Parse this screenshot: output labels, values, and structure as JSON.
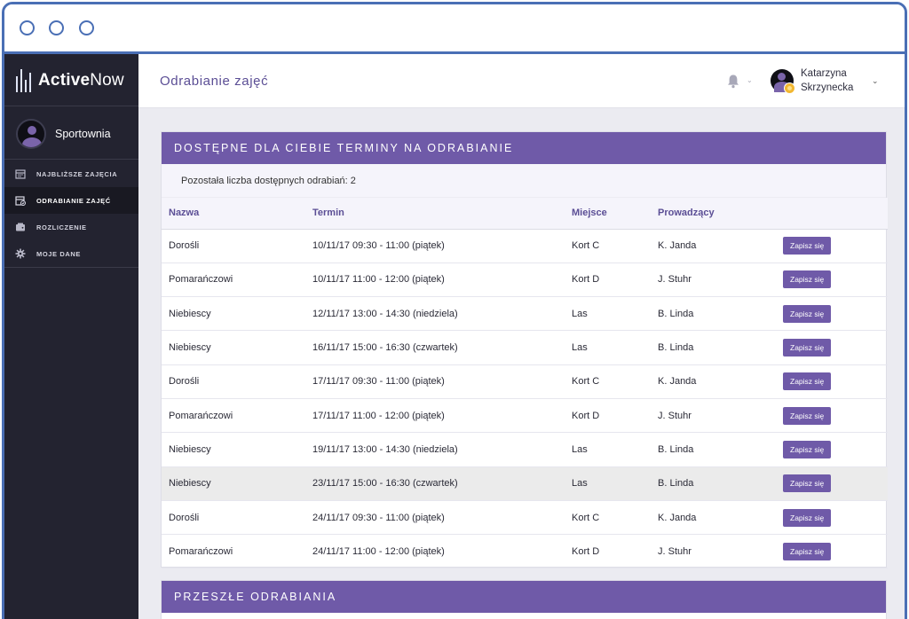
{
  "app": {
    "logo_bold": "Active",
    "logo_light": "Now"
  },
  "sidebar": {
    "company": "Sportownia",
    "items": [
      {
        "label": "Najbliższe zajęcia",
        "icon": "calendar-icon"
      },
      {
        "label": "Odrabianie zajęć",
        "icon": "calendar-check-icon"
      },
      {
        "label": "Rozliczenie",
        "icon": "wallet-icon"
      },
      {
        "label": "Moje dane",
        "icon": "gear-icon"
      }
    ]
  },
  "header": {
    "title": "Odrabianie zajęć",
    "user_first": "Katarzyna",
    "user_last": "Skrzynecka"
  },
  "available": {
    "title": "Dostępne dla ciebie terminy na odrabianie",
    "remaining": "Pozostała liczba dostępnych odrabiań: 2",
    "columns": [
      "Nazwa",
      "Termin",
      "Miejsce",
      "Prowadzący"
    ],
    "button_label": "Zapisz się",
    "rows": [
      {
        "name": "Dorośli",
        "date": "10/11/17 09:30 - 11:00 (piątek)",
        "place": "Kort C",
        "coach": "K. Janda"
      },
      {
        "name": "Pomarańczowi",
        "date": "10/11/17 11:00 - 12:00 (piątek)",
        "place": "Kort D",
        "coach": "J. Stuhr"
      },
      {
        "name": "Niebiescy",
        "date": "12/11/17 13:00 - 14:30 (niedziela)",
        "place": "Las",
        "coach": "B. Linda"
      },
      {
        "name": "Niebiescy",
        "date": "16/11/17 15:00 - 16:30 (czwartek)",
        "place": "Las",
        "coach": "B. Linda"
      },
      {
        "name": "Dorośli",
        "date": "17/11/17 09:30 - 11:00 (piątek)",
        "place": "Kort C",
        "coach": "K. Janda"
      },
      {
        "name": "Pomarańczowi",
        "date": "17/11/17 11:00 - 12:00 (piątek)",
        "place": "Kort D",
        "coach": "J. Stuhr"
      },
      {
        "name": "Niebiescy",
        "date": "19/11/17 13:00 - 14:30 (niedziela)",
        "place": "Las",
        "coach": "B. Linda"
      },
      {
        "name": "Niebiescy",
        "date": "23/11/17 15:00 - 16:30 (czwartek)",
        "place": "Las",
        "coach": "B. Linda",
        "hovered": true
      },
      {
        "name": "Dorośli",
        "date": "24/11/17 09:30 - 11:00 (piątek)",
        "place": "Kort C",
        "coach": "K. Janda"
      },
      {
        "name": "Pomarańczowi",
        "date": "24/11/17 11:00 - 12:00 (piątek)",
        "place": "Kort D",
        "coach": "J. Stuhr"
      }
    ]
  },
  "past": {
    "title": "Przeszłe odrabiania"
  },
  "colors": {
    "accent": "#6f5aa8",
    "sidebar": "#232330",
    "frame": "#4a6fb5"
  }
}
